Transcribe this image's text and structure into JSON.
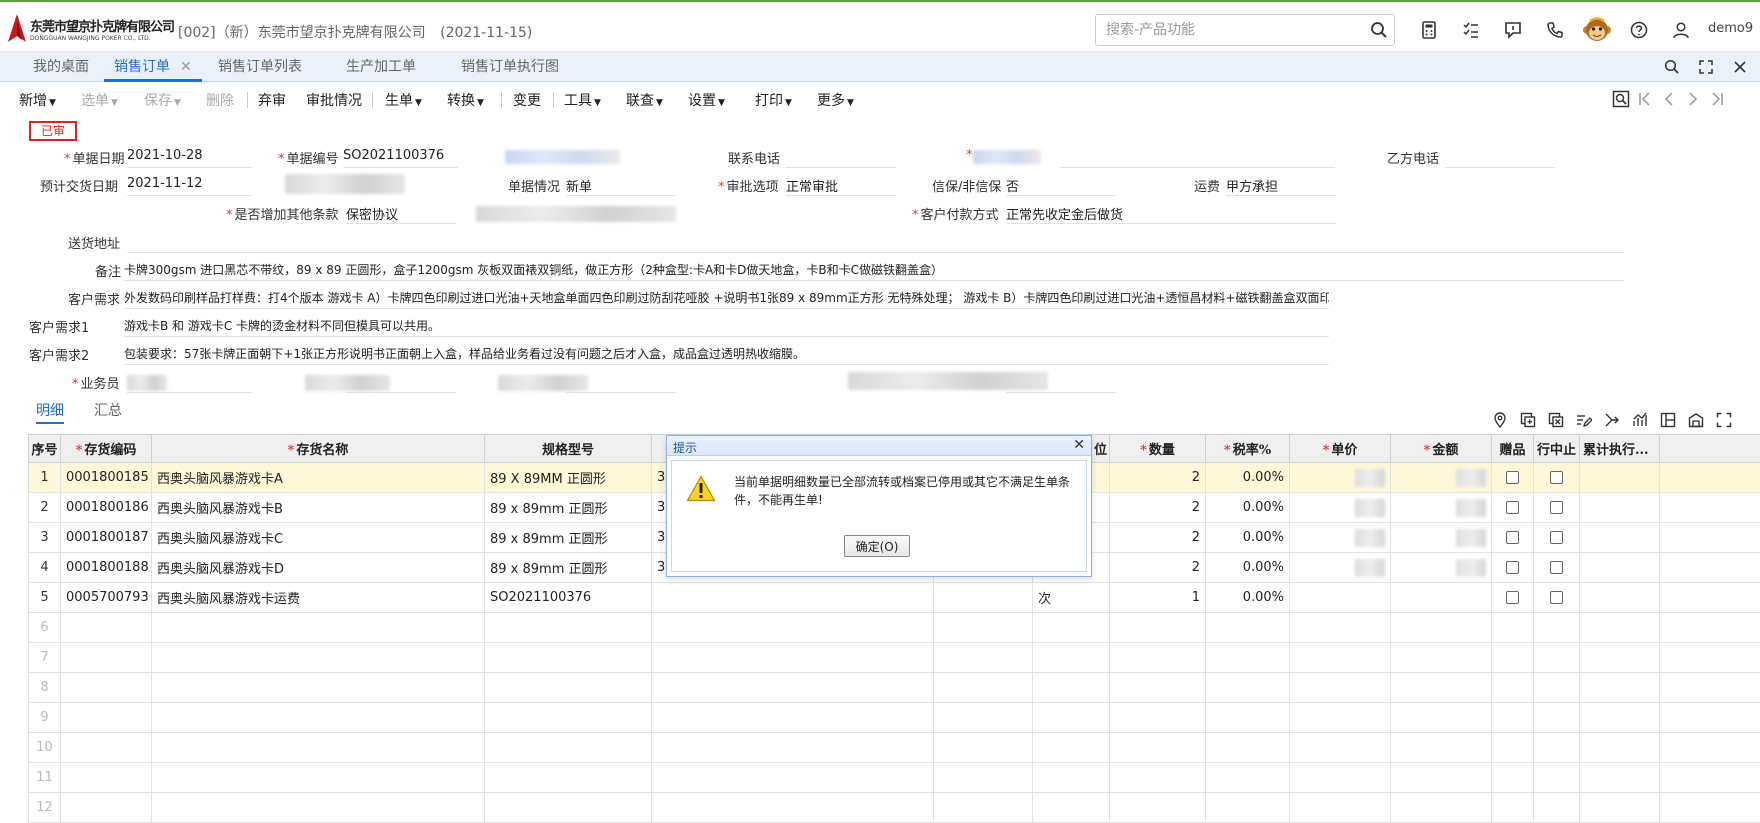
{
  "header": {
    "logo_cn": "东莞市望京扑克牌有限公司",
    "logo_en": "DONGGUAN WANGJING POKER CO., LTD.",
    "company": "[002]（新）东莞市望京扑克牌有限公司",
    "date": "(2021-11-15)",
    "search_placeholder": "搜索-产品功能",
    "user": "demo9"
  },
  "tabs": [
    {
      "label": "我的桌面"
    },
    {
      "label": "销售订单",
      "active": true,
      "close": "✕"
    },
    {
      "label": "销售订单列表"
    },
    {
      "label": "生产加工单"
    },
    {
      "label": "销售订单执行图"
    }
  ],
  "toolbar": {
    "add": "新增",
    "select": "选单",
    "save": "保存",
    "delete": "删除",
    "abandon": "弃审",
    "approval": "审批情况",
    "gen": "生单",
    "convert": "转换",
    "change": "变更",
    "tools": "工具",
    "link": "联查",
    "settings": "设置",
    "print": "打印",
    "more": "更多"
  },
  "status": "已审",
  "form": {
    "doc_date_label": "单据日期",
    "doc_date": "2021-10-28",
    "doc_no_label": "单据编号",
    "doc_no": "SO2021100376",
    "phone_label": "联系电话",
    "b_phone_label": "乙方电话",
    "delivery_date_label": "预计交货日期",
    "delivery_date": "2021-11-12",
    "doc_status_label": "单据情况",
    "doc_status": "新单",
    "approval_label": "审批选项",
    "approval": "正常审批",
    "credit_label": "信保/非信保",
    "credit": "否",
    "freight_label": "运费",
    "freight": "甲方承担",
    "extra_terms_label": "是否增加其他条款",
    "extra_terms": "保密协议",
    "payment_label": "客户付款方式",
    "payment": "正常先收定金后做货",
    "address_label": "送货地址",
    "remark_label": "备注",
    "remark": "卡牌300gsm 进口黑芯不带纹，89 x 89 正圆形，盒子1200gsm 灰板双面裱双铜纸，做正方形（2种盒型:卡A和卡D做天地盒，卡B和卡C做磁铁翻盖盒）",
    "need_label": "客户需求",
    "need": "外发数码印刷样品打样费：打4个版本  游戏卡 A）卡牌四色印刷过进口光油+天地盒单面四色印刷过防刮花哑胶 +说明书1张89 x 89mm正方形 无特殊处理；  游戏卡 B）卡牌四色印刷过进口光油+透恒昌材料+磁铁翻盖盒双面印...",
    "need1_label": "客户需求1",
    "need1": "游戏卡B 和 游戏卡C 卡牌的烫金材料不同但模具可以共用。",
    "need2_label": "客户需求2",
    "need2": "包装要求：57张卡牌正面朝下+1张正方形说明书正面朝上入盒，样品给业务看过没有问题之后才入盒，成品盒过透明热收缩膜。",
    "sales_label": "业务员"
  },
  "detail_tabs": {
    "detail": "明细",
    "summary": "汇总"
  },
  "grid": {
    "headers": {
      "idx": "序号",
      "code": "存货编码",
      "name": "存货名称",
      "spec": "规格型号",
      "unit": "位",
      "qty": "数量",
      "tax": "税率%",
      "price": "单价",
      "amount": "金额",
      "gift": "赠品",
      "stop": "行中止",
      "exec": "累计执行..."
    },
    "rows": [
      {
        "idx": "1",
        "code": "0001800185",
        "name": "西奥头脑风暴游戏卡A",
        "spec": "89 X 89MM 正圆形",
        "c4": "3",
        "unit": "",
        "qty": "2",
        "tax": "0.00%"
      },
      {
        "idx": "2",
        "code": "0001800186",
        "name": "西奥头脑风暴游戏卡B",
        "spec": "89 x 89mm 正圆形",
        "c4": "3",
        "unit": "",
        "qty": "2",
        "tax": "0.00%"
      },
      {
        "idx": "3",
        "code": "0001800187",
        "name": "西奥头脑风暴游戏卡C",
        "spec": "89 x 89mm 正圆形",
        "c4": "3",
        "unit": "",
        "qty": "2",
        "tax": "0.00%"
      },
      {
        "idx": "4",
        "code": "0001800188",
        "name": "西奥头脑风暴游戏卡D",
        "spec": "89 x 89mm 正圆形",
        "c4": "3",
        "unit": "",
        "qty": "2",
        "tax": "0.00%"
      },
      {
        "idx": "5",
        "code": "0005700793",
        "name": "西奥头脑风暴游戏卡运费",
        "spec": "SO2021100376",
        "c4": "",
        "unit": "次",
        "qty": "1",
        "tax": "0.00%"
      }
    ],
    "empty_rows": [
      "6",
      "7",
      "8",
      "9",
      "10",
      "11",
      "12"
    ]
  },
  "dialog": {
    "title": "提示",
    "message": "当前单据明细数量已全部流转或档案已停用或其它不满足生单条件，不能再生单!",
    "ok": "确定(O)"
  }
}
